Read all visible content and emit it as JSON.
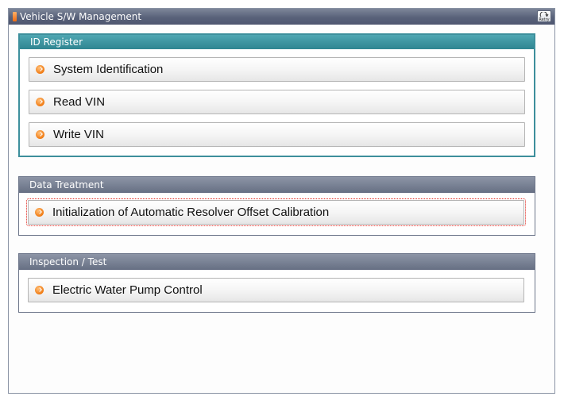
{
  "window": {
    "title": "Vehicle S/W Management",
    "retry_label": "Retry"
  },
  "sections": [
    {
      "title": "ID Register",
      "items": [
        "System Identification",
        "Read VIN",
        "Write VIN"
      ]
    },
    {
      "title": "Data Treatment",
      "items": [
        "Initialization of Automatic Resolver Offset Calibration"
      ]
    },
    {
      "title": "Inspection / Test",
      "items": [
        "Electric Water Pump Control"
      ]
    }
  ],
  "colors": {
    "accent_orange": "#f07a12",
    "id_register_header": "#3d8f9c",
    "section_header": "#6d768a",
    "selection_outline": "#e0241b"
  }
}
